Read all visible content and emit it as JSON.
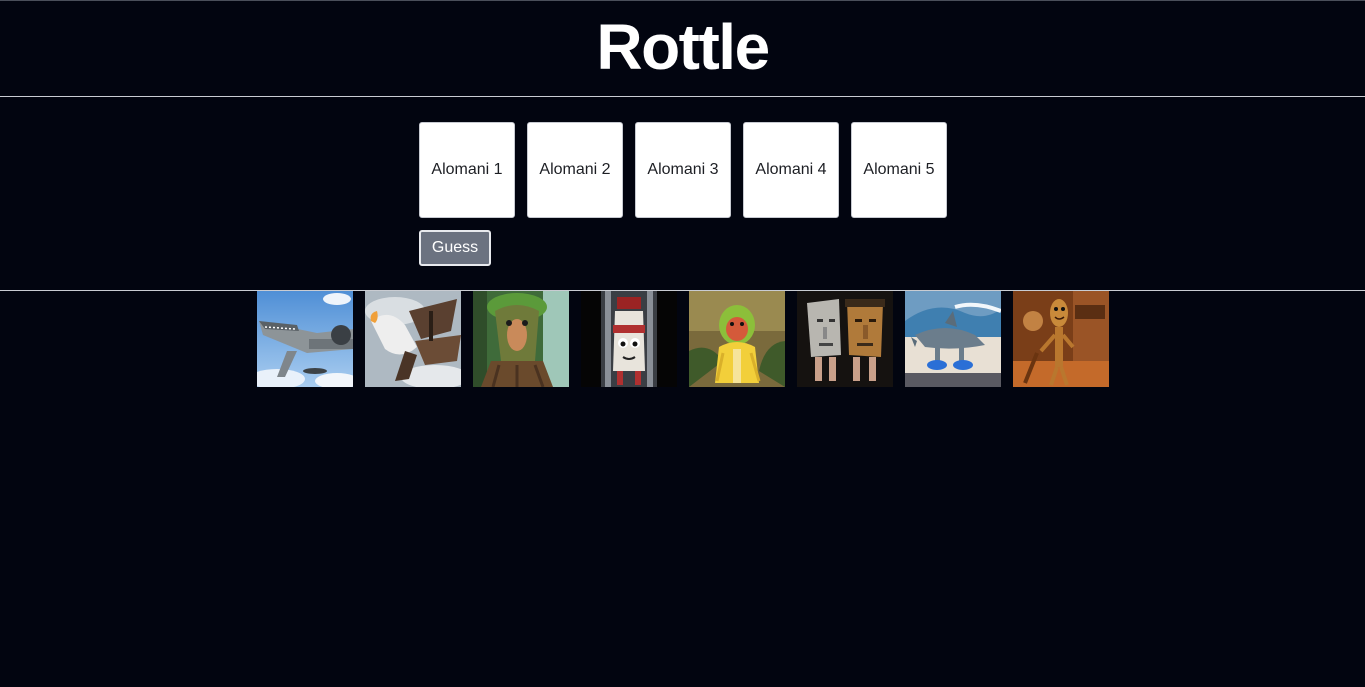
{
  "header": {
    "title": "Rottle"
  },
  "guess": {
    "slots": [
      "Alomani 1",
      "Alomani 2",
      "Alomani 3",
      "Alomani 4",
      "Alomani 5"
    ],
    "button_label": "Guess"
  },
  "gallery": {
    "images": [
      {
        "subject": "crocodile-airplane"
      },
      {
        "subject": "goose-bomber"
      },
      {
        "subject": "tree-nose-creature"
      },
      {
        "subject": "cartoon-tube-character"
      },
      {
        "subject": "monkey-banana"
      },
      {
        "subject": "stone-faces-with-legs"
      },
      {
        "subject": "shark-in-sneakers"
      },
      {
        "subject": "wooden-stick-figure"
      }
    ]
  },
  "colors": {
    "background": "#020510",
    "slot_background": "#ffffff",
    "button_background": "#6b7280",
    "divider": "#c9ccd2"
  }
}
